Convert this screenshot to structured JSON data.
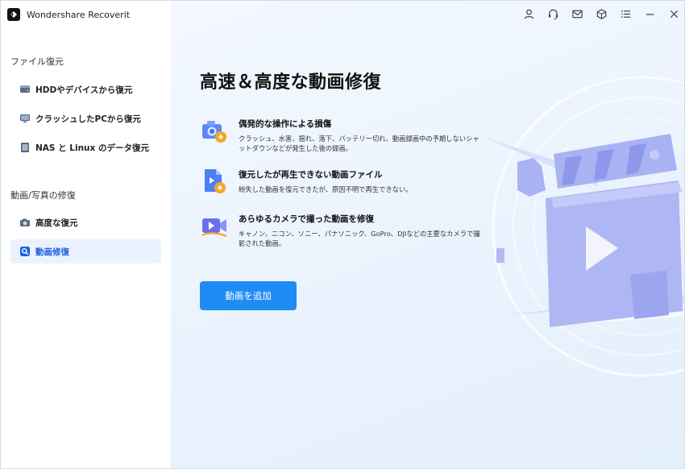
{
  "app": {
    "title": "Wondershare Recoverit"
  },
  "sidebar": {
    "sections": [
      {
        "label": "ファイル復元",
        "items": [
          {
            "label": "HDDやデバイスから復元",
            "icon": "hdd-icon"
          },
          {
            "label": "クラッシュしたPCから復元",
            "icon": "crashed-pc-icon"
          },
          {
            "label": "NAS と Linux のデータ復元",
            "icon": "nas-icon"
          }
        ]
      },
      {
        "label": "動画/写真の修復",
        "items": [
          {
            "label": "高度な復元",
            "icon": "camera-icon"
          },
          {
            "label": "動画修復",
            "icon": "video-repair-icon",
            "active": true
          }
        ]
      }
    ]
  },
  "toolbar": {
    "icons": [
      "user-icon",
      "headset-icon",
      "mail-icon",
      "cube-icon",
      "menu-icon",
      "minimize-icon",
      "close-icon"
    ]
  },
  "main": {
    "headline": "高速＆高度な動画修復",
    "features": [
      {
        "title": "偶発的な操作による損傷",
        "desc": "クラッシュ、水害、揺れ、落下、バッテリー切れ、動画録画中の予期しないシャットダウンなどが発生した後の録画。"
      },
      {
        "title": "復元したが再生できない動画ファイル",
        "desc": "紛失した動画を復元できたが、原因不明で再生できない。"
      },
      {
        "title": "あらゆるカメラで撮った動画を修復",
        "desc": "キャノン、ニコン、ソニー、パナソニック、GoPro、DJIなどの主要なカメラで撮影された動画。"
      }
    ],
    "add_button": "動画を追加"
  },
  "colors": {
    "accent": "#1f8cf3",
    "active_text": "#1f5fe0",
    "active_bg": "#ebf2fd",
    "illustration": "#a9b2f2"
  }
}
